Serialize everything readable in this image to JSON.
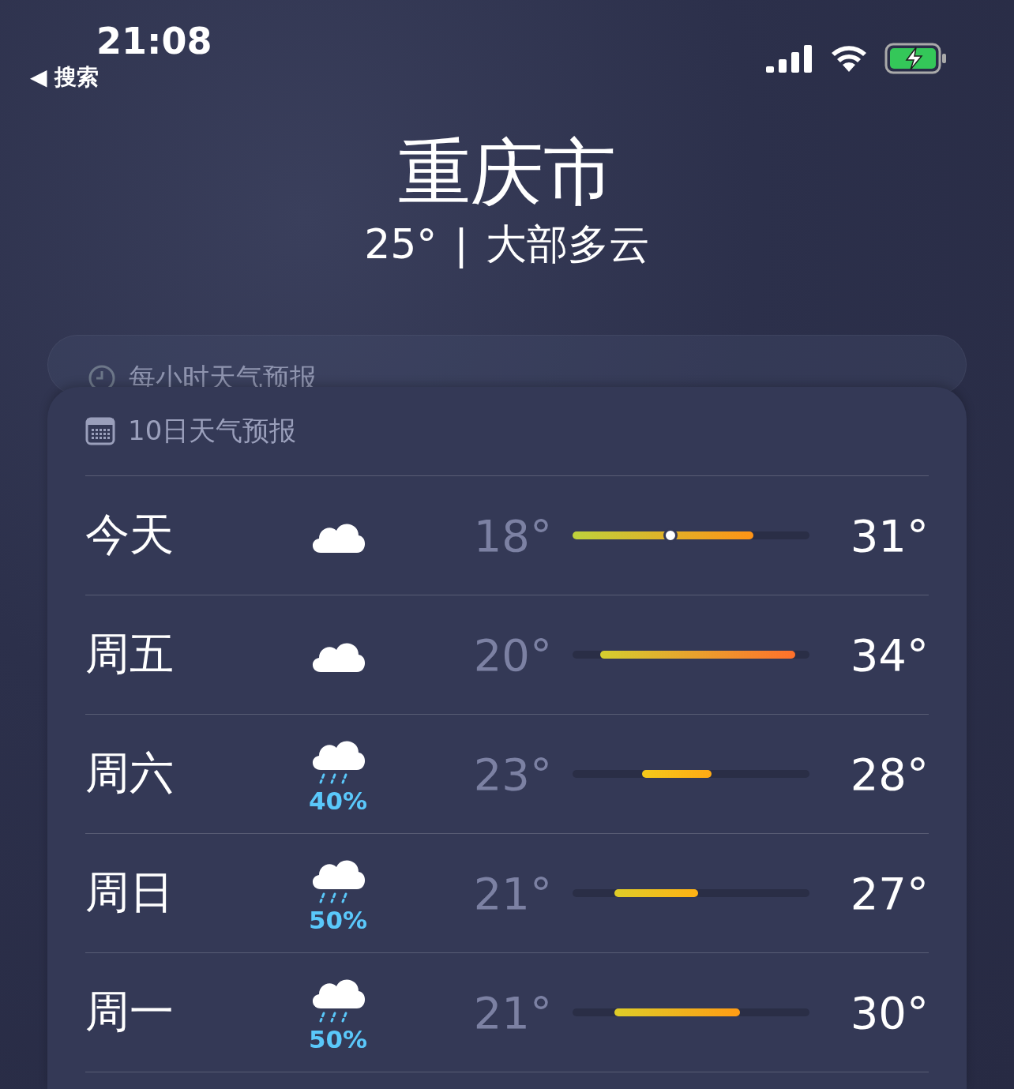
{
  "status_bar": {
    "time": "21:08",
    "back": "◀ 搜索"
  },
  "location": {
    "city": "重庆市",
    "temperature": "25°",
    "separator": "|",
    "condition": "大部多云"
  },
  "hourly_card": {
    "title": "每小时天气预报"
  },
  "daily_card": {
    "title": "10日天气预报",
    "days": [
      {
        "day": "今天",
        "kind": "cloud",
        "low": "18°",
        "high": "31°",
        "current": true
      },
      {
        "day": "周五",
        "kind": "cloud",
        "low": "20°",
        "high": "34°",
        "current": false
      },
      {
        "day": "周六",
        "kind": "rain",
        "chance": "40%",
        "low": "23°",
        "high": "28°",
        "current": false
      },
      {
        "day": "周日",
        "kind": "rain",
        "chance": "50%",
        "low": "21°",
        "high": "27°",
        "current": false
      },
      {
        "day": "周一",
        "kind": "rain",
        "chance": "50%",
        "low": "21°",
        "high": "30°",
        "current": false
      }
    ]
  }
}
